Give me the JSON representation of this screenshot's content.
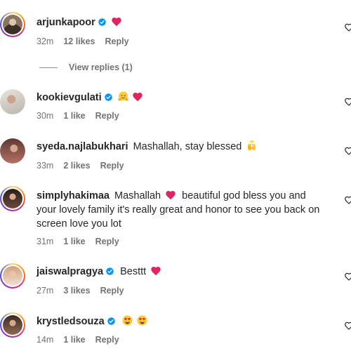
{
  "comments": [
    {
      "username": "arjunkapoor",
      "verified": true,
      "text": "",
      "time": "32m",
      "likes": "12 likes",
      "reply": "Reply",
      "view_replies": "View replies (1)"
    },
    {
      "username": "kookievgulati",
      "verified": true,
      "text": "",
      "time": "30m",
      "likes": "1 like",
      "reply": "Reply"
    },
    {
      "username": "syeda.najlabukhari",
      "verified": false,
      "text": "Mashallah, stay blessed",
      "time": "33m",
      "likes": "2 likes",
      "reply": "Reply"
    },
    {
      "username": "simplyhakimaa",
      "verified": false,
      "text_a": "Mashallah",
      "text_b": "beautiful god bless you and",
      "text_c": "your lovely family it's really great and honor to see you back on",
      "text_d": "screen love you lot",
      "time": "31m",
      "likes": "1 like",
      "reply": "Reply"
    },
    {
      "username": "jaiswalpragya",
      "verified": true,
      "text": "Besttt",
      "time": "27m",
      "likes": "3 likes",
      "reply": "Reply"
    },
    {
      "username": "krystledsouza",
      "verified": true,
      "text": "",
      "time": "14m",
      "likes": "1 like",
      "reply": "Reply"
    }
  ],
  "colors": {
    "heart": "#ed4956",
    "verified": "#0095f6",
    "meta": "#737373"
  },
  "icons": [
    "heart-emoji",
    "hugging-face-emoji",
    "raised-hands-emoji",
    "heart-eyes-emoji",
    "verified-badge-icon",
    "like-heart-outline-icon"
  ]
}
